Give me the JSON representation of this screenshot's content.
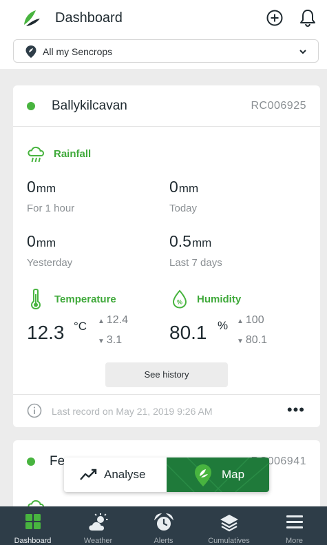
{
  "header": {
    "title": "Dashboard",
    "filter": {
      "selected": "All my Sencrops"
    }
  },
  "station1": {
    "name": "Ballykilcavan",
    "id": "RC006925",
    "rainfall": {
      "title": "Rainfall",
      "last_hour": {
        "value": "0",
        "unit": "mm",
        "label": "For 1 hour"
      },
      "today": {
        "value": "0",
        "unit": "mm",
        "label": "Today"
      },
      "yesterday": {
        "value": "0",
        "unit": "mm",
        "label": "Yesterday"
      },
      "last7": {
        "value": "0.5",
        "unit": "mm",
        "label": "Last 7 days"
      }
    },
    "temperature": {
      "title": "Temperature",
      "value": "12.3",
      "unit": "°C",
      "max": "12.4",
      "min": "3.1"
    },
    "humidity": {
      "title": "Humidity",
      "value": "80.1",
      "unit": "%",
      "max": "100",
      "min": "80.1"
    },
    "history_button": "See history",
    "last_record": "Last record on May 21, 2019 9:26 AM",
    "more": "•••"
  },
  "station2": {
    "name": "Fe",
    "id": "RC006941"
  },
  "view_toggle": {
    "analyse": "Analyse",
    "map": "Map"
  },
  "tabs": [
    {
      "label": "Dashboard",
      "icon": "grid-icon",
      "active": true
    },
    {
      "label": "Weather",
      "icon": "weather-icon",
      "active": false
    },
    {
      "label": "Alerts",
      "icon": "alarm-clock-icon",
      "active": false
    },
    {
      "label": "Cumulatives",
      "icon": "layers-icon",
      "active": false
    },
    {
      "label": "More",
      "icon": "menu-icon",
      "active": false
    }
  ],
  "colors": {
    "accent": "#48b43f",
    "section_title": "#3fa93a",
    "tabbar": "#2e3d48",
    "map_button": "#1f7a3a"
  }
}
